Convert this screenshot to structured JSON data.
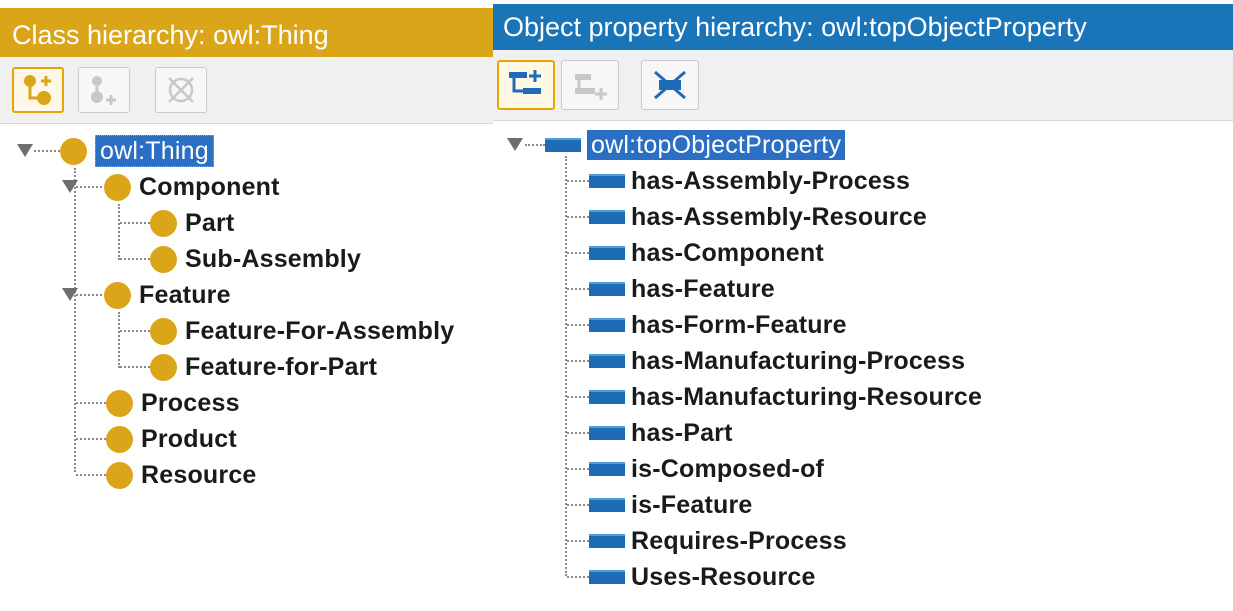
{
  "class_panel": {
    "title": "Class hierarchy: owl:Thing",
    "title_bg": "#dba519",
    "toolbar": [
      {
        "name": "add-subclass-button",
        "icon": "add-subclass-icon",
        "enabled": true
      },
      {
        "name": "add-sibling-class-button",
        "icon": "add-sibling-class-icon",
        "enabled": false
      },
      {
        "name": "delete-class-button",
        "icon": "delete-class-icon",
        "enabled": false
      }
    ],
    "root": "owl:Thing",
    "items": {
      "component": "Component",
      "part": "Part",
      "sub_assembly": "Sub-Assembly",
      "feature": "Feature",
      "feature_for_assembly": "Feature-For-Assembly",
      "feature_for_part": "Feature-for-Part",
      "process": "Process",
      "product": "Product",
      "resource": "Resource"
    }
  },
  "property_panel": {
    "title": "Object property hierarchy: owl:topObjectProperty",
    "title_bg": "#1a74b8",
    "toolbar": [
      {
        "name": "add-subproperty-button",
        "icon": "add-subproperty-icon",
        "enabled": true
      },
      {
        "name": "add-sibling-property-button",
        "icon": "add-sibling-property-icon",
        "enabled": false
      },
      {
        "name": "delete-property-button",
        "icon": "delete-property-icon",
        "enabled": true
      }
    ],
    "root": "owl:topObjectProperty",
    "items": [
      "has-Assembly-Process",
      "has-Assembly-Resource",
      "has-Component",
      "has-Feature",
      "has-Form-Feature",
      "has-Manufacturing-Process",
      "has-Manufacturing-Resource",
      "has-Part",
      "is-Composed-of",
      "is-Feature",
      "Requires-Process",
      "Uses-Resource"
    ]
  },
  "colors": {
    "class_dot": "#dba519",
    "property_bar": "#1f6cb6",
    "selection": "#2a6fc4"
  }
}
